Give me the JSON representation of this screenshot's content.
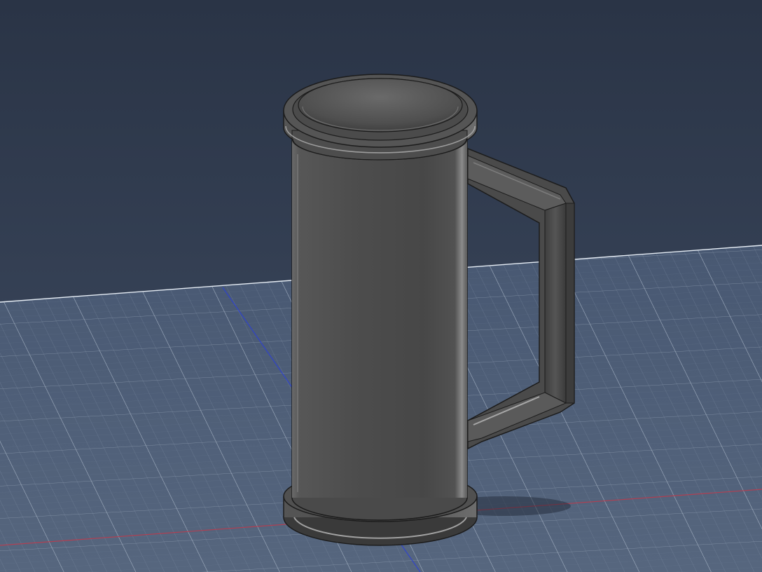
{
  "viewport": {
    "background_top": "#2a3446",
    "background_bottom": "#3f4c62",
    "ground_color": "#46566e",
    "grid_minor_color": "#7c8ca3",
    "grid_major_color": "#a9b6c8",
    "axis_x_color": "#c0394b",
    "axis_z_color": "#2b3fd6",
    "horizon_color": "#e6edf5"
  },
  "model": {
    "type": "mug",
    "body_color": "#4a4a4a",
    "edge_color": "#1c1c1c",
    "highlight_color": "#b8b8b8",
    "handle_color": "#4b4b4b"
  },
  "scene": {
    "shadow": true,
    "grid_visible": true
  }
}
